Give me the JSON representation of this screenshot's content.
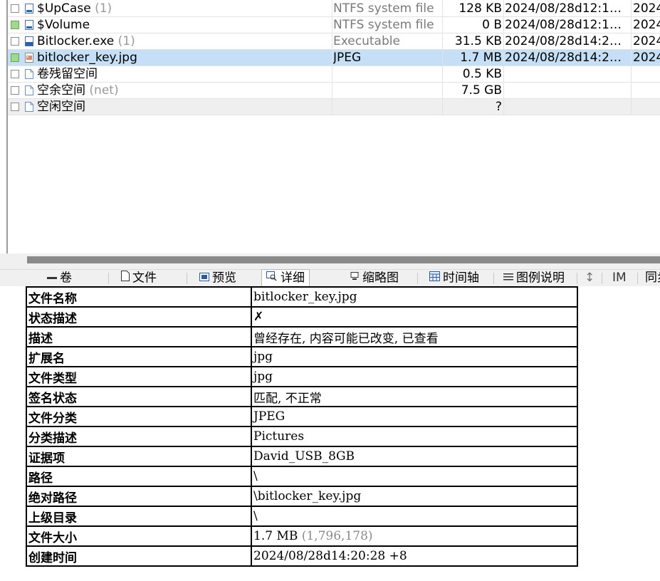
{
  "files": [
    {
      "name": "$UpCase",
      "count": "(1)",
      "type": "NTFS system file",
      "size": "128 KB",
      "date1": "2024/08/28d12:1…",
      "date2": "2024",
      "checked": false,
      "icon": "system-file-icon"
    },
    {
      "name": "$Volume",
      "count": "",
      "type": "NTFS system file",
      "size": "0 B",
      "date1": "2024/08/28d12:1…",
      "date2": "2024",
      "checked": true,
      "icon": "system-file-icon"
    },
    {
      "name": "Bitlocker.exe",
      "count": "(1)",
      "type": "Executable",
      "size": "31.5 KB",
      "date1": "2024/08/28d14:2…",
      "date2": "2024",
      "checked": false,
      "icon": "executable-file-icon"
    },
    {
      "name": "bitlocker_key.jpg",
      "count": "",
      "type": "JPEG",
      "size": "1.7 MB",
      "date1": "2024/08/28d14:2…",
      "date2": "2024",
      "checked": true,
      "selected": true,
      "icon": "image-file-icon"
    },
    {
      "name": "卷残留空间",
      "count": "",
      "type": "",
      "size": "0.5 KB",
      "date1": "",
      "date2": "",
      "checked": false,
      "icon": "file-icon"
    },
    {
      "name": "空余空间",
      "count": "(net)",
      "type": "",
      "size": "7.5 GB",
      "date1": "",
      "date2": "",
      "checked": false,
      "icon": "file-icon"
    },
    {
      "name": "空闲空间",
      "count": "",
      "type": "",
      "size": "?",
      "date1": "",
      "date2": "",
      "checked": false,
      "icon": "file-icon"
    }
  ],
  "tabs": [
    {
      "label": "卷",
      "icon": "volume-icon"
    },
    {
      "label": "文件",
      "icon": "document-icon"
    },
    {
      "label": "预览",
      "icon": "preview-icon"
    },
    {
      "label": "详细",
      "icon": "details-icon",
      "active": true
    },
    {
      "label": "缩略图",
      "icon": "thumbnail-icon"
    },
    {
      "label": "时间轴",
      "icon": "calendar-icon"
    },
    {
      "label": "图例说明",
      "icon": "legend-icon"
    },
    {
      "label": "↕",
      "icon": "sort-arrows-icon"
    },
    {
      "label": "IM",
      "icon": ""
    },
    {
      "label": "同步",
      "icon": ""
    }
  ],
  "details": [
    {
      "key": "文件名称",
      "value": "bitlocker_key.jpg",
      "extra": ""
    },
    {
      "key": "状态描述",
      "value": "✗",
      "extra": ""
    },
    {
      "key": "描述",
      "value": "曾经存在, 内容可能已改变, 已查看",
      "extra": ""
    },
    {
      "key": "扩展名",
      "value": "jpg",
      "extra": ""
    },
    {
      "key": "文件类型",
      "value": "jpg",
      "extra": ""
    },
    {
      "key": "签名状态",
      "value": "匹配, 不正常",
      "extra": ""
    },
    {
      "key": "文件分类",
      "value": "JPEG",
      "extra": ""
    },
    {
      "key": "分类描述",
      "value": "Pictures",
      "extra": ""
    },
    {
      "key": "证据项",
      "value": "David_USB_8GB",
      "extra": ""
    },
    {
      "key": "路径",
      "value": "\\",
      "extra": ""
    },
    {
      "key": "绝对路径",
      "value": "\\bitlocker_key.jpg",
      "extra": ""
    },
    {
      "key": "上级目录",
      "value": "\\",
      "extra": ""
    },
    {
      "key": "文件大小",
      "value": "1.7 MB",
      "extra": "(1,796,178)"
    },
    {
      "key": "创建时间",
      "value": "2024/08/28d14:20:28 +8",
      "extra": ""
    }
  ],
  "colors": {
    "selected_row": "#c4dff6",
    "checkbox_green": "#9fd98e",
    "muted_text": "#9a9a9a"
  }
}
